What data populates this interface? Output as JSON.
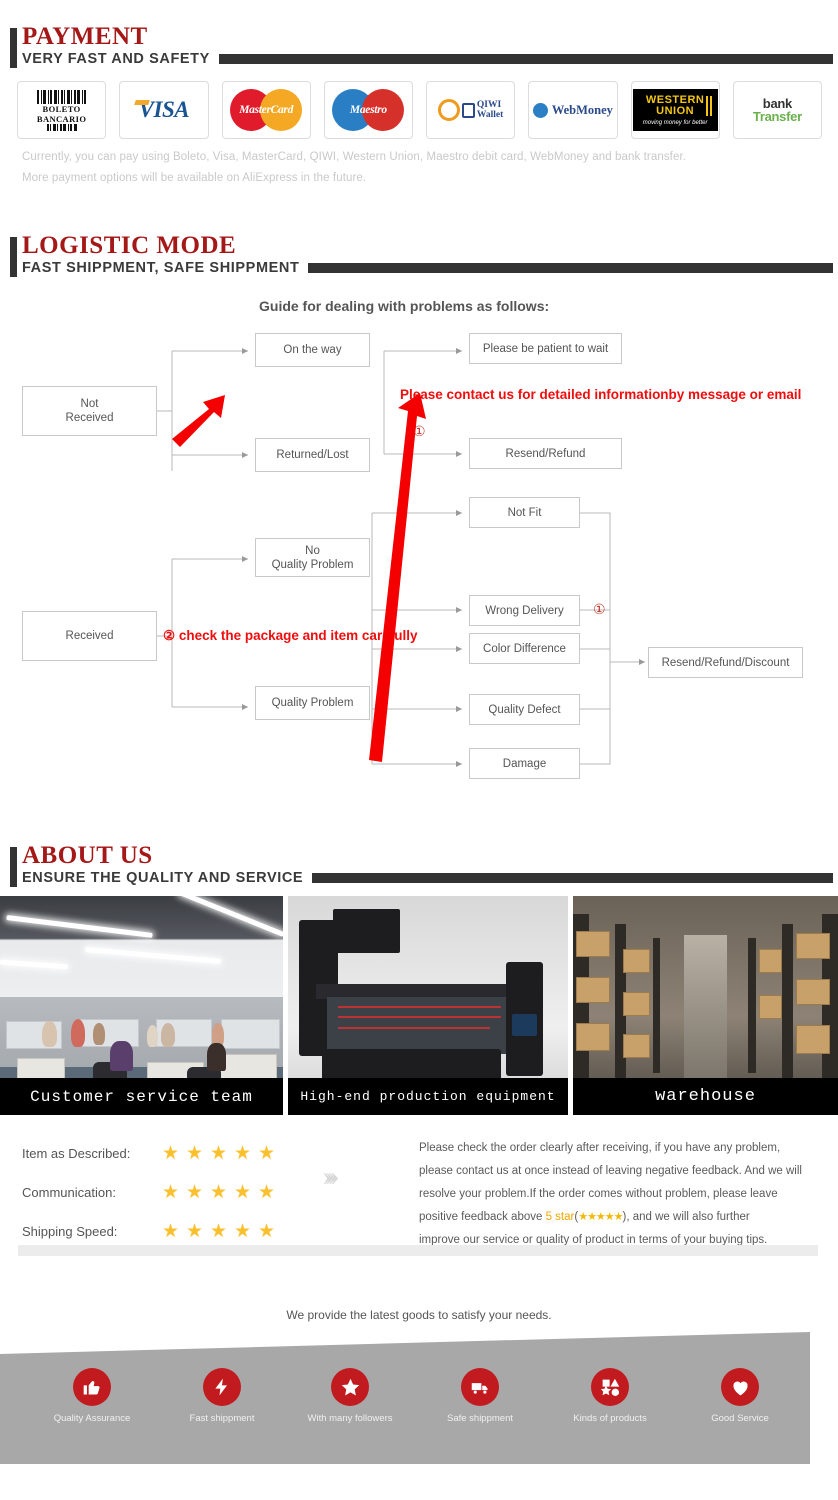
{
  "sections": {
    "payment": {
      "title": "PAYMENT",
      "subtitle": "VERY FAST AND SAFETY",
      "methods": [
        {
          "name": "boleto-bancario-logo",
          "line1": "BOLETO",
          "line2": "BANCARIO"
        },
        {
          "name": "visa-logo",
          "text": "VISA"
        },
        {
          "name": "mastercard-logo",
          "text": "MasterCard"
        },
        {
          "name": "maestro-logo",
          "text": "Maestro"
        },
        {
          "name": "qiwi-wallet-logo",
          "line1": "QIWI",
          "line2": "Wallet"
        },
        {
          "name": "webmoney-logo",
          "text": "WebMoney"
        },
        {
          "name": "western-union-logo",
          "line1": "WESTERN",
          "line2": "UNION",
          "tagline": "moving money for better"
        },
        {
          "name": "bank-transfer-logo",
          "line1": "bank",
          "line2": "Transfer"
        }
      ],
      "note_line_1": "Currently, you can pay using Boleto, Visa, MasterCard, QIWI, Western Union, Maestro debit card, WebMoney and bank transfer.",
      "note_line_2": "More payment options will be available on AliExpress in the future."
    },
    "logistic": {
      "title": "LOGISTIC MODE",
      "subtitle": "FAST SHIPPMENT, SAFE SHIPPMENT",
      "guide_heading": "Guide for dealing with problems as follows:",
      "nodes": {
        "not_received": "Not\nReceived",
        "on_the_way": "On the way",
        "returned_lost": "Returned/Lost",
        "please_wait": "Please be patient to wait",
        "resend_refund": "Resend/Refund",
        "received": "Received",
        "no_quality_problem": "No\nQuality Problem",
        "quality_problem": "Quality Problem",
        "not_fit": "Not Fit",
        "wrong_delivery": "Wrong Delivery",
        "color_difference": "Color Difference",
        "quality_defect": "Quality Defect",
        "damage": "Damage",
        "resend_refund_discount": "Resend/Refund/Discount"
      },
      "annotations": {
        "note_1": "Please contact us for detailed informationby message or email",
        "note_2": "② check the package and item carefully",
        "marker_1": "①",
        "marker_2": "①"
      }
    },
    "about": {
      "title": "ABOUT US",
      "subtitle": "ENSURE THE QUALITY AND SERVICE",
      "photos": [
        {
          "name": "office-photo",
          "caption": "Customer service team"
        },
        {
          "name": "production-equipment-photo",
          "caption": "High-end production equipment"
        },
        {
          "name": "warehouse-photo",
          "caption": "warehouse"
        }
      ]
    },
    "ratings": {
      "rows": [
        {
          "label": "Item as Described:",
          "stars": 5
        },
        {
          "label": "Communication:",
          "stars": 5
        },
        {
          "label": "Shipping Speed:",
          "stars": 5
        }
      ],
      "chevrons": "››››",
      "feedback": {
        "line1": "Please check the order clearly after receiving, if you have any problem,",
        "line2": "please contact us at once instead of leaving negative feedback. And we will",
        "line3": "resolve your problem.If the order comes without problem, please leave",
        "line4_pre": "positive feedback above ",
        "line4_highlight": "5 star",
        "line4_paren_open": "(",
        "line4_stars": "★★★★★",
        "line4_post": "), and we will also further",
        "line5": "improve our service or quality of product in terms of your buying tips."
      }
    },
    "footer": {
      "tagline": "We provide the latest goods to satisfy your needs.",
      "features": [
        {
          "icon": "thumbs-up-icon",
          "label": "Quality Assurance"
        },
        {
          "icon": "lightning-bolt-icon",
          "label": "Fast shippment"
        },
        {
          "icon": "star-icon",
          "label": "With many followers"
        },
        {
          "icon": "truck-icon",
          "label": "Safe shippment"
        },
        {
          "icon": "shapes-icon",
          "label": "Kinds of products"
        },
        {
          "icon": "heart-icon",
          "label": "Good Service"
        }
      ]
    }
  },
  "colors": {
    "heading_red": "#a51818",
    "dark_bar": "#333333",
    "annotation_red": "#f10d0d",
    "star_yellow": "#fbc02d",
    "banner_gray": "#a8a8a8",
    "badge_red": "#c11a1f"
  }
}
